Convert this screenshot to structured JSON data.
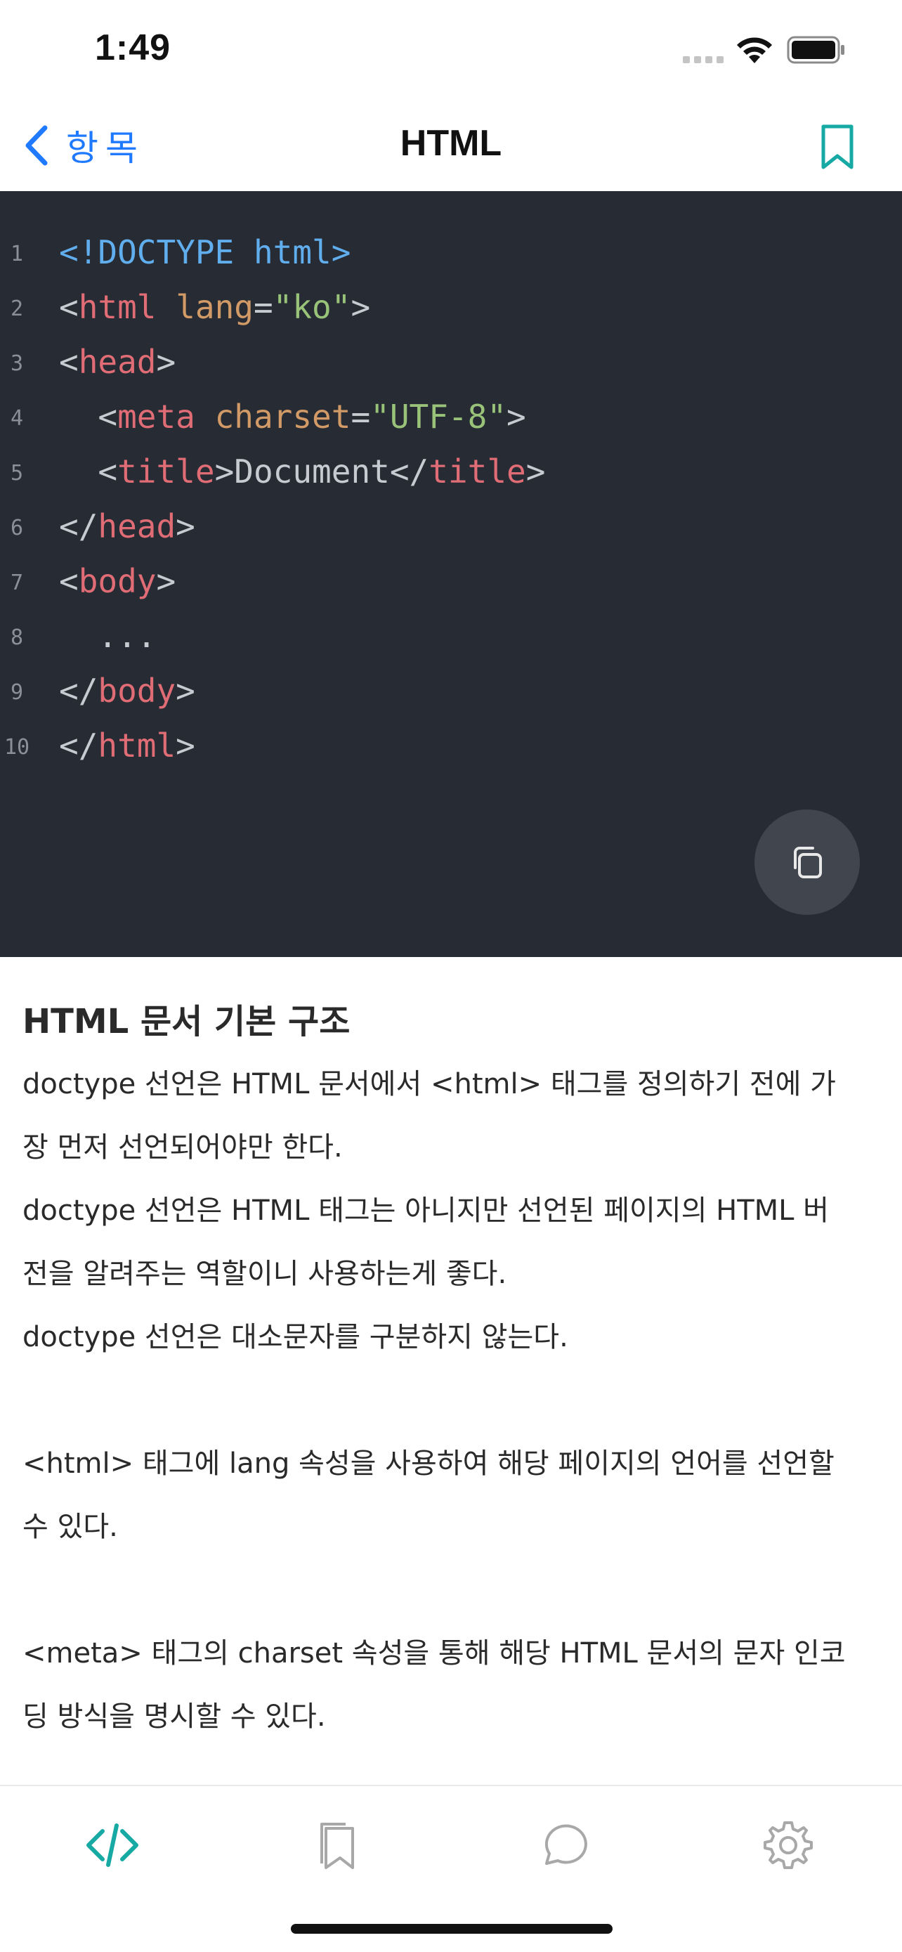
{
  "status_bar": {
    "time": "1:49"
  },
  "nav": {
    "back_label": "항목",
    "title": "HTML"
  },
  "code": {
    "lines": [
      {
        "n": "1",
        "tokens": [
          [
            "doctype",
            "<!DOCTYPE html>"
          ]
        ]
      },
      {
        "n": "2",
        "tokens": [
          [
            "punct",
            "<"
          ],
          [
            "tag",
            "html"
          ],
          [
            "plain",
            " "
          ],
          [
            "attr",
            "lang"
          ],
          [
            "punct",
            "="
          ],
          [
            "str",
            "\"ko\""
          ],
          [
            "punct",
            ">"
          ]
        ]
      },
      {
        "n": "3",
        "tokens": [
          [
            "punct",
            "<"
          ],
          [
            "tag",
            "head"
          ],
          [
            "punct",
            ">"
          ]
        ]
      },
      {
        "n": "4",
        "tokens": [
          [
            "plain",
            "  "
          ],
          [
            "punct",
            "<"
          ],
          [
            "tag",
            "meta"
          ],
          [
            "plain",
            " "
          ],
          [
            "attr",
            "charset"
          ],
          [
            "punct",
            "="
          ],
          [
            "str",
            "\"UTF-8\""
          ],
          [
            "punct",
            ">"
          ]
        ]
      },
      {
        "n": "5",
        "tokens": [
          [
            "plain",
            "  "
          ],
          [
            "punct",
            "<"
          ],
          [
            "tag",
            "title"
          ],
          [
            "punct",
            ">"
          ],
          [
            "plain",
            "Document"
          ],
          [
            "punct",
            "</"
          ],
          [
            "tag",
            "title"
          ],
          [
            "punct",
            ">"
          ]
        ]
      },
      {
        "n": "6",
        "tokens": [
          [
            "punct",
            "</"
          ],
          [
            "tag",
            "head"
          ],
          [
            "punct",
            ">"
          ]
        ]
      },
      {
        "n": "7",
        "tokens": [
          [
            "punct",
            "<"
          ],
          [
            "tag",
            "body"
          ],
          [
            "punct",
            ">"
          ]
        ]
      },
      {
        "n": "8",
        "tokens": [
          [
            "plain",
            "  ..."
          ]
        ]
      },
      {
        "n": "9",
        "tokens": [
          [
            "punct",
            "</"
          ],
          [
            "tag",
            "body"
          ],
          [
            "punct",
            ">"
          ]
        ]
      },
      {
        "n": "10",
        "tokens": [
          [
            "punct",
            "</"
          ],
          [
            "tag",
            "html"
          ],
          [
            "punct",
            ">"
          ]
        ]
      }
    ]
  },
  "content": {
    "title": "HTML 문서 기본 구조",
    "lines": [
      "doctype 선언은 HTML 문서에서 <html> 태그를 정의하기 전에 가",
      "장 먼저 선언되어야만 한다.",
      "doctype 선언은 HTML 태그는 아니지만 선언된 페이지의 HTML 버",
      "전을 알려주는 역할이니 사용하는게 좋다.",
      "doctype 선언은 대소문자를 구분하지 않는다.",
      "",
      "<html> 태그에 lang 속성을 사용하여 해당 페이지의 언어를 선언할",
      "수 있다.",
      "",
      "<meta> 태그의 charset 속성을 통해 해당 HTML 문서의 문자 인코",
      "딩 방식을 명시할 수 있다."
    ]
  },
  "icons": {
    "back": "chevron-left-icon",
    "bookmark_nav": "bookmark-icon",
    "copy": "copy-icon",
    "tabs": [
      "code-icon",
      "bookmark-icon",
      "chat-icon",
      "gear-icon"
    ]
  },
  "colors": {
    "accent_blue": "#1f7aff",
    "accent_teal": "#17a9a4",
    "code_bg": "#272b33",
    "inactive_icon": "#a8a8a8"
  }
}
